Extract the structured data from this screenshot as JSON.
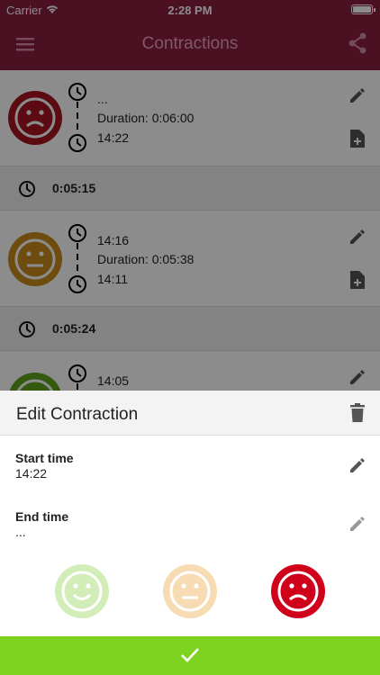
{
  "status": {
    "carrier": "Carrier",
    "time": "2:28 PM"
  },
  "app": {
    "title": "Contractions"
  },
  "contractions": [
    {
      "top": "...",
      "duration": "Duration: 0:06:00",
      "bottom": "14:22",
      "mood": "sad",
      "color": "#a7151f"
    },
    {
      "top": "14:16",
      "duration": "Duration: 0:05:38",
      "bottom": "14:11",
      "mood": "neutral",
      "color": "#c88b1d"
    },
    {
      "top": "14:05",
      "mood": "happy",
      "color": "#5fa21d"
    }
  ],
  "intervals": [
    "0:05:15",
    "0:05:24"
  ],
  "sheet": {
    "title": "Edit Contraction",
    "start_label": "Start time",
    "start_value": "14:22",
    "end_label": "End time",
    "end_value": "..."
  },
  "moods": [
    {
      "name": "happy",
      "color": "#d2edb8"
    },
    {
      "name": "neutral",
      "color": "#f7dbb3"
    },
    {
      "name": "sad",
      "color": "#d0021b"
    }
  ],
  "colors": {
    "appbar": "#8b1e40",
    "confirm": "#7ed321"
  }
}
